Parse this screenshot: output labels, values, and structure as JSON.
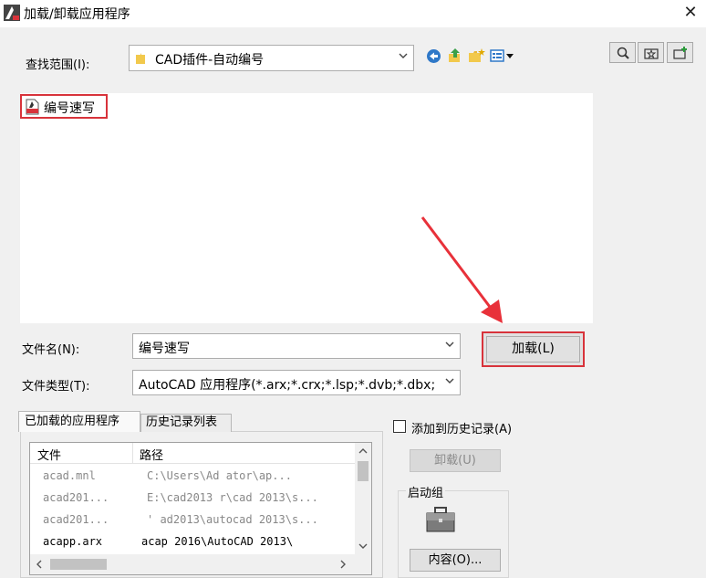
{
  "window": {
    "title": "加载/卸载应用程序",
    "close_glyph": "✕"
  },
  "lookin": {
    "label": "查找范围(I):",
    "value": "CAD插件-自动编号"
  },
  "file_list": {
    "items": [
      {
        "name": "编号速写"
      }
    ]
  },
  "filename": {
    "label": "文件名(N):",
    "value": "编号速写"
  },
  "filetype": {
    "label": "文件类型(T):",
    "value": "AutoCAD 应用程序(*.arx;*.crx;*.lsp;*.dvb;*.dbx;"
  },
  "load_button": {
    "label": "加载(L)"
  },
  "tabs": [
    {
      "label": "已加载的应用程序",
      "active": true
    },
    {
      "label": "历史记录列表",
      "active": false
    }
  ],
  "loaded_list": {
    "columns": [
      "文件",
      "路径"
    ],
    "rows": [
      {
        "file": "acad.mnl",
        "path": "C:\\Users\\Ad       ator\\ap...",
        "dim": true
      },
      {
        "file": "acad201...",
        "path": "E:\\cad2013  r\\cad 2013\\s...",
        "dim": true
      },
      {
        "file": "acad201...",
        "path": "'  ad2013\\autocad 2013\\s...",
        "dim": true
      },
      {
        "file": "acapp.arx",
        "path": "acap  2016\\AutoCAD 2013\\",
        "dim": false
      }
    ]
  },
  "add_history": {
    "label": "添加到历史记录(A)",
    "checked": false
  },
  "unload_button": {
    "label": "卸载(U)"
  },
  "startup_group": {
    "label": "启动组",
    "contents_button": "内容(O)..."
  },
  "colors": {
    "highlight_red": "#d8333b",
    "folder_yellow": "#e8b73a",
    "back_blue": "#2f78c8"
  },
  "icons": {
    "back": "back-arrow-icon",
    "up": "up-folder-icon",
    "newfolder": "new-folder-icon",
    "views": "view-menu-icon"
  }
}
